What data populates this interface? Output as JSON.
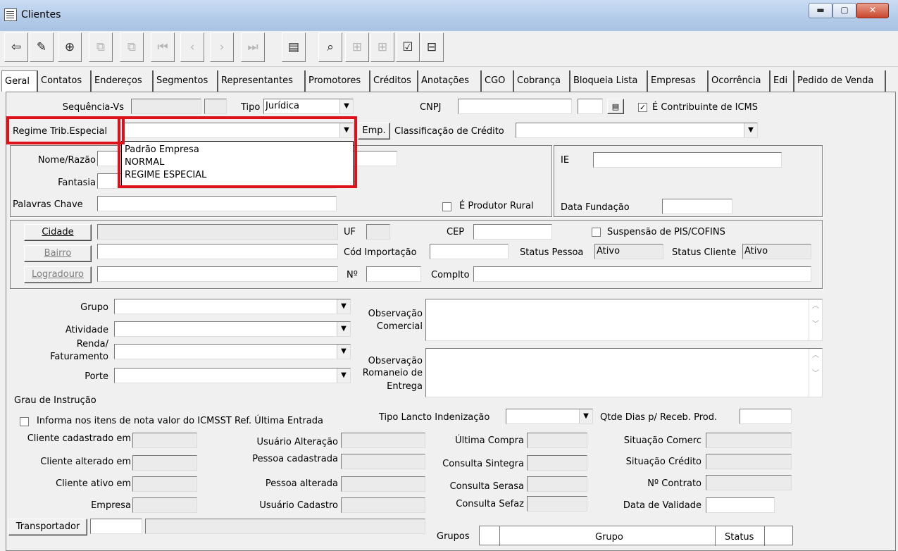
{
  "window": {
    "title": "Clientes"
  },
  "tabs": [
    "Geral",
    "Contatos",
    "Endereços",
    "Segmentos",
    "Representantes",
    "Promotores",
    "Créditos",
    "Anotações",
    "CGO",
    "Cobrança",
    "Bloqueia Lista",
    "Empresas",
    "Ocorrência",
    "Edi",
    "Pedido de Venda"
  ],
  "toolbar": {
    "icons": [
      "exit-icon",
      "edit-icon",
      "add-icon",
      "dup-icon",
      "dup2-icon",
      "first-icon",
      "prev-icon",
      "next-icon",
      "last-icon",
      "notes-icon",
      "search-icon",
      "link-icon",
      "link2-icon",
      "checklist-icon",
      "tree-icon"
    ]
  },
  "form": {
    "sequencia_label": "Sequência-Vs",
    "tipo_label": "Tipo",
    "tipo_value": "Jurídica",
    "cnpj_label": "CNPJ",
    "contribuinte_label": "É Contribuinte de ICMS",
    "contribuinte_checked": "✓",
    "regime_label": "Regime Trib.Especial",
    "emp_label": "Emp.",
    "classificacao_label": "Classificação de Crédito",
    "regime_options": [
      "Padrão Empresa",
      "NORMAL",
      "REGIME ESPECIAL"
    ],
    "nome_label": "Nome/Razão",
    "fantasia_label": "Fantasia",
    "palavras_label": "Palavras Chave",
    "produtor_label": "É Produtor Rural",
    "ie_label": "IE",
    "data_fundacao_label": "Data Fundação",
    "cidade_btn": "Cidade",
    "bairro_btn": "Bairro",
    "logradouro_btn": "Logradouro",
    "uf_label": "UF",
    "cep_label": "CEP",
    "suspensao_label": "Suspensão de PIS/COFINS",
    "cod_importacao_label": "Cód Importação",
    "status_pessoa_label": "Status Pessoa",
    "status_pessoa_value": "Ativo",
    "status_cliente_label": "Status Cliente",
    "status_cliente_value": "Ativo",
    "numero_label": "Nº",
    "complto_label": "Complto",
    "grupo_label": "Grupo",
    "atividade_label": "Atividade",
    "renda_label": "Renda/",
    "faturamento_label": "Faturamento",
    "porte_label": "Porte",
    "grau_label": "Grau de Instrução",
    "obs_comercial_label_1": "Observação",
    "obs_comercial_label_2": "Comercial",
    "obs_romaneio_label_1": "Observação",
    "obs_romaneio_label_2": "Romaneio de",
    "obs_romaneio_label_3": "Entrega",
    "informa_label": "Informa nos itens de nota valor do ICMSST Ref. Última Entrada",
    "tipo_lancto_label": "Tipo Lancto Indenização",
    "qtde_dias_label": "Qtde Dias p/ Receb. Prod.",
    "cli_cadastrado_label": "Cliente cadastrado em",
    "usuario_alteracao_label": "Usuário Alteração",
    "ultima_compra_label": "Última Compra",
    "situacao_comerc_label": "Situação Comerc",
    "cli_alterado_label": "Cliente alterado em",
    "pessoa_cadastrada_label": "Pessoa cadastrada",
    "consulta_sintegra_label": "Consulta Sintegra",
    "situacao_credito_label": "Situação Crédito",
    "cli_ativo_label": "Cliente ativo em",
    "pessoa_alterada_label": "Pessoa alterada",
    "consulta_serasa_label": "Consulta Serasa",
    "n_contrato_label": "Nº Contrato",
    "empresa_label": "Empresa",
    "usuario_cadastro_label": "Usuário Cadastro",
    "consulta_sefaz_label": "Consulta Sefaz",
    "data_validade_label": "Data de Validade",
    "transportador_btn": "Transportador",
    "grupos_label": "Grupos",
    "grid_col_grupo": "Grupo",
    "grid_col_status": "Status"
  },
  "colors": {
    "highlight": "#e0101a"
  }
}
